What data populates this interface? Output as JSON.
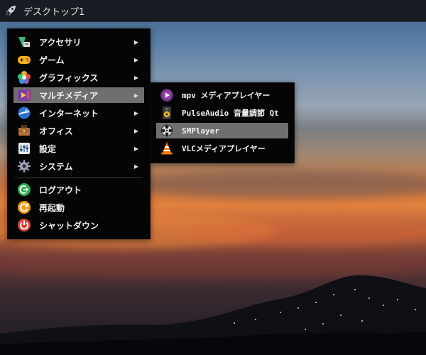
{
  "panel": {
    "title": "デスクトップ1"
  },
  "menu": {
    "items": [
      {
        "label": "アクセサリ",
        "icon": "accessories-icon"
      },
      {
        "label": "ゲーム",
        "icon": "gamepad-icon"
      },
      {
        "label": "グラフィックス",
        "icon": "graphics-icon"
      },
      {
        "label": "マルチメディア",
        "icon": "multimedia-icon"
      },
      {
        "label": "インターネット",
        "icon": "internet-icon"
      },
      {
        "label": "オフィス",
        "icon": "office-icon"
      },
      {
        "label": "設定",
        "icon": "settings-icon"
      },
      {
        "label": "システム",
        "icon": "system-gear-icon"
      }
    ],
    "actions": [
      {
        "label": "ログアウト",
        "icon": "logout-icon"
      },
      {
        "label": "再起動",
        "icon": "reboot-icon"
      },
      {
        "label": "シャットダウン",
        "icon": "shutdown-icon"
      }
    ],
    "active_index": 3
  },
  "submenu": {
    "items": [
      {
        "label": "mpv メディアプレイヤー",
        "icon": "mpv-icon"
      },
      {
        "label": "PulseAudio 音量調節 Qt",
        "icon": "speaker-icon"
      },
      {
        "label": "SMPlayer",
        "icon": "smplayer-icon"
      },
      {
        "label": "VLCメディアプレイヤー",
        "icon": "vlc-cone-icon"
      }
    ],
    "active_index": 2
  },
  "colors": {
    "highlight": "#6f6f6f",
    "menu_bg": "#050506",
    "panel_bg": "#171b22"
  }
}
